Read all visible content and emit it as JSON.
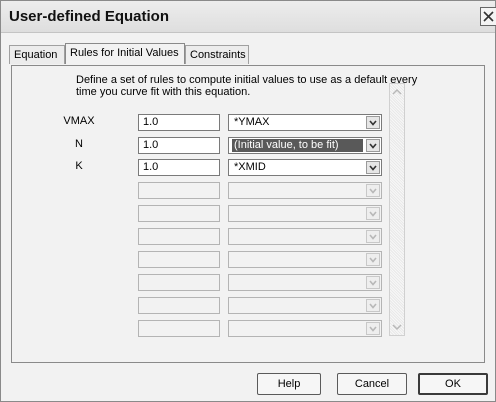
{
  "window": {
    "title": "User-defined Equation"
  },
  "tabs": [
    {
      "label": "Equation"
    },
    {
      "label": "Rules for Initial Values"
    },
    {
      "label": "Constraints"
    }
  ],
  "description": "Define a set of rules to compute initial values to use as a default every time you curve fit with this equation.",
  "rules": [
    {
      "param": "VMAX",
      "value": "1.0",
      "rule": "*YMAX"
    },
    {
      "param": "N",
      "value": "1.0",
      "rule": "(Initial value, to be fit)"
    },
    {
      "param": "K",
      "value": "1.0",
      "rule": "*XMID"
    }
  ],
  "buttons": {
    "help": "Help",
    "cancel": "Cancel",
    "ok": "OK"
  },
  "icons": {
    "close": "close-icon",
    "dropdown": "chevron-down-icon",
    "scroll_up": "scroll-up-arrow-icon",
    "scroll_down": "scroll-down-arrow-icon"
  }
}
